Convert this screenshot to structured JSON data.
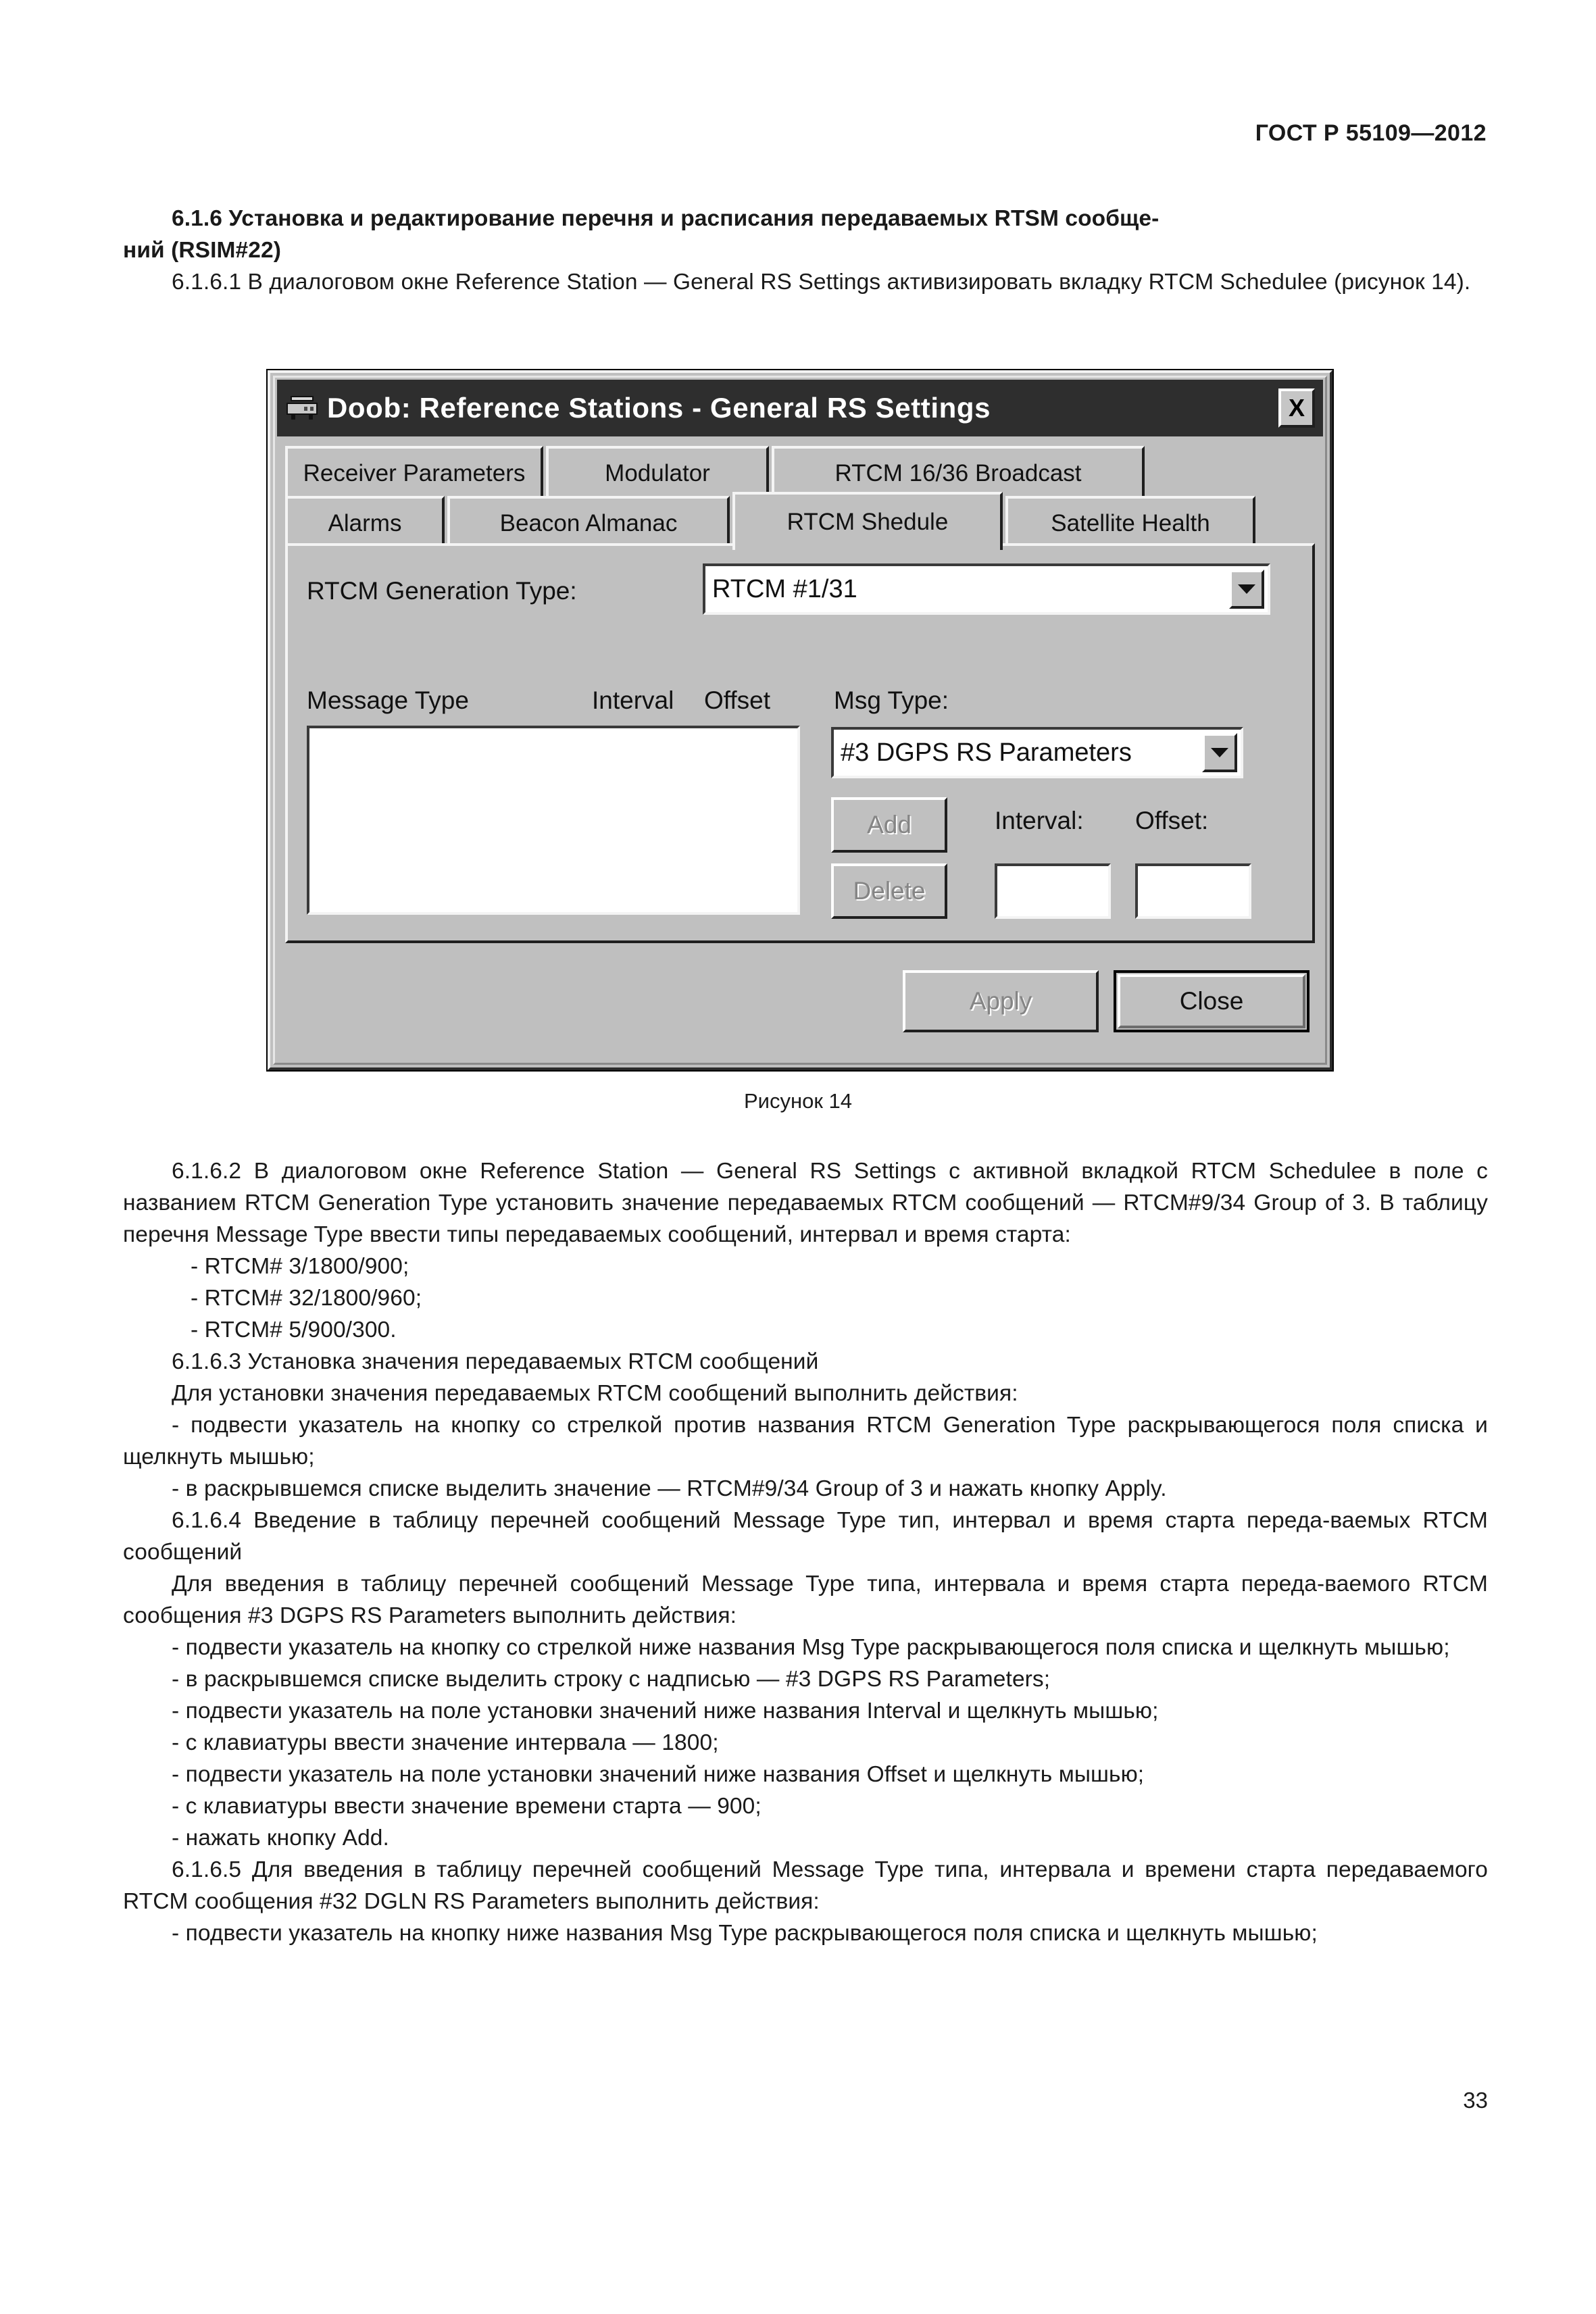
{
  "document": {
    "header_standard": "ГОСТ Р 55109—2012",
    "page_number": "33",
    "figure_caption": "Рисунок 14"
  },
  "body": {
    "heading_6_1_6_line1": "6.1.6 Установка  и  редактирование  перечня  и расписания  передаваемых  RTSM сообще-",
    "heading_6_1_6_line2": "ний (RSIM#22)",
    "para_6_1_6_1": "6.1.6.1 В диалоговом окне Reference Station — General RS Settings активизировать вкладку RTCM Schedulee (рисунок 14).",
    "para_6_1_6_2": "6.1.6.2 В диалоговом окне Reference Station  — General RS Settings с активной вкладкой RTCM Schedulee в поле  с названием RTCM Generation Type установить  значение  передаваемых RTCM сообщений — RTCM#9/34 Group of 3. В таблицу перечня Message Type ввести типы передаваемых сообщений, интервал и время старта:",
    "list_rtcm": [
      "- RTCM# 3/1800/900;",
      "- RTCM# 32/1800/960;",
      "- RTCM# 5/900/300."
    ],
    "para_6_1_6_3": "6.1.6.3 Установка значения передаваемых RTCM сообщений",
    "para_6_1_6_3_intro": "Для установки значения передаваемых RTCM сообщений выполнить действия:",
    "list_6_1_6_3": [
      "- подвести указатель на кнопку со стрелкой против названия RTCM Generation Type раскрывающегося поля списка и щелкнуть мышью;",
      "- в раскрывшемся списке выделить значение — RTCM#9/34 Group of 3 и нажать кнопку Apply."
    ],
    "para_6_1_6_4": "6.1.6.4 Введение в таблицу перечней сообщений Message Type тип, интервал и время старта переда-ваемых RTCM сообщений",
    "para_6_1_6_4_intro": "Для введения в таблицу перечней сообщений Message Type типа, интервала и время старта переда-ваемого RTCM сообщения  #3 DGPS RS Parameters  выполнить действия:",
    "list_6_1_6_4": [
      "- подвести указатель на кнопку со стрелкой ниже названия Msg Type раскрывающегося поля списка и щелкнуть мышью;",
      "- в раскрывшемся списке выделить строку с надписью — #3 DGPS RS Parameters;",
      "- подвести указатель на поле установки значений ниже названия Interval и щелкнуть мышью;",
      "- с клавиатуры ввести значение интервала — 1800;",
      "- подвести указатель на поле установки значений ниже названия Offset и щелкнуть мышью;",
      "- с клавиатуры ввести значение времени старта — 900;",
      "- нажать кнопку  Add."
    ],
    "para_6_1_6_5": "6.1.6.5 Для введения в таблицу перечней сообщений Message Type типа, интервала и времени старта передаваемого RTCM сообщения #32 DGLN RS Parameters выполнить действия:",
    "list_6_1_6_5": [
      "- подвести указатель на кнопку ниже названия Msg Type раскрывающегося поля списка и щелкнуть мышью;"
    ]
  },
  "dialog": {
    "title": "Doob: Reference Stations - General RS Settings",
    "title_icon": "receiver-device-icon",
    "close_label": "X",
    "tabs_row1": [
      {
        "label": "Receiver Parameters",
        "active": false
      },
      {
        "label": "Modulator",
        "active": false
      },
      {
        "label": "RTCM 16/36 Broadcast",
        "active": false
      }
    ],
    "tabs_row2": [
      {
        "label": "Alarms",
        "active": false
      },
      {
        "label": "Beacon Almanac",
        "active": false
      },
      {
        "label": "RTCM Shedule",
        "active": true
      },
      {
        "label": "Satellite Health",
        "active": false
      }
    ],
    "generation_type_label": "RTCM Generation Type:",
    "generation_type_value": "RTCM #1/31",
    "column_headers": {
      "message_type": "Message Type",
      "interval": "Interval",
      "offset": "Offset"
    },
    "message_list_items": [],
    "msg_type_label": "Msg Type:",
    "msg_type_value": "#3 DGPS RS Parameters",
    "add_label": "Add",
    "delete_label": "Delete",
    "interval_label": "Interval:",
    "offset_label": "Offset:",
    "interval_value": "",
    "offset_value": "",
    "apply_label": "Apply",
    "close_button_label": "Close",
    "colors": {
      "face": "#bfbfbf",
      "titlebar": "#2e2e2e",
      "field": "#ffffff",
      "disabled_text": "#858585"
    }
  }
}
